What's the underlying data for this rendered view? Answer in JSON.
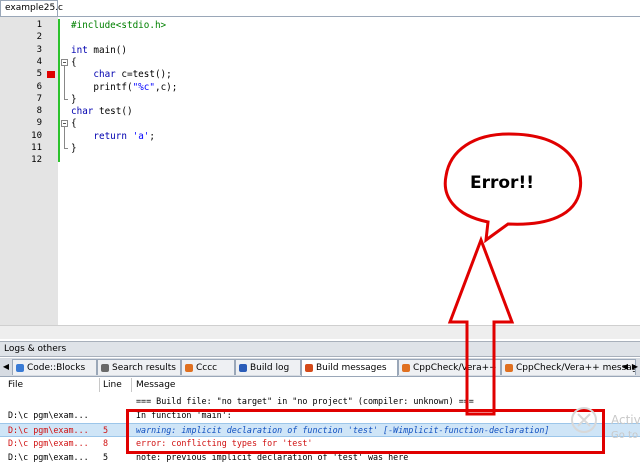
{
  "editor": {
    "tab_label": "example25.c",
    "line_numbers": [
      "1",
      "2",
      "3",
      "4",
      "5",
      "6",
      "7",
      "8",
      "9",
      "10",
      "11",
      "12"
    ],
    "code_lines": [
      [
        {
          "t": "#include<stdio.h>",
          "c": "pp"
        }
      ],
      [],
      [
        {
          "t": "int",
          "c": "kw"
        },
        {
          "t": " main()",
          "c": ""
        }
      ],
      [
        {
          "t": "{",
          "c": ""
        }
      ],
      [
        {
          "t": "    ",
          "c": ""
        },
        {
          "t": "char",
          "c": "kw"
        },
        {
          "t": " c=test();",
          "c": ""
        }
      ],
      [
        {
          "t": "    printf(",
          "c": ""
        },
        {
          "t": "\"%c\"",
          "c": "str"
        },
        {
          "t": ",c);",
          "c": ""
        }
      ],
      [
        {
          "t": "}",
          "c": ""
        }
      ],
      [
        {
          "t": "char",
          "c": "kw"
        },
        {
          "t": " test()",
          "c": ""
        }
      ],
      [
        {
          "t": "{",
          "c": ""
        }
      ],
      [
        {
          "t": "    ",
          "c": ""
        },
        {
          "t": "return",
          "c": "kw"
        },
        {
          "t": " ",
          "c": ""
        },
        {
          "t": "'a'",
          "c": "chr"
        },
        {
          "t": ";",
          "c": ""
        }
      ],
      [
        {
          "t": "}",
          "c": ""
        }
      ],
      []
    ],
    "error_marker_line": "5"
  },
  "logs": {
    "caption": "Logs & others",
    "tabs": [
      {
        "label": "Code::Blocks",
        "icon_color": "#3a7bd5"
      },
      {
        "label": "Search results",
        "icon_color": "#6a6a6a"
      },
      {
        "label": "Cccc",
        "icon_color": "#e07020"
      },
      {
        "label": "Build log",
        "icon_color": "#2a5cb8"
      },
      {
        "label": "Build messages",
        "icon_color": "#d44a1a"
      },
      {
        "label": "CppCheck/Vera++",
        "icon_color": "#e07020"
      },
      {
        "label": "CppCheck/Vera++ messages",
        "icon_color": "#e07020"
      }
    ],
    "active_tab": "Build messages",
    "columns": {
      "file": "File",
      "line": "Line",
      "message": "Message"
    },
    "rows": [
      {
        "file": "",
        "line": "",
        "message": "=== Build file: \"no target\" in \"no project\" (compiler: unknown) ===",
        "kind": "normal"
      },
      {
        "file": "D:\\c pgm\\exam...",
        "line": "",
        "message": "In function 'main':",
        "kind": "normal"
      },
      {
        "file": "D:\\c pgm\\exam...",
        "line": "5",
        "message": "warning: implicit declaration of function 'test' [-Wimplicit-function-declaration]",
        "kind": "warn"
      },
      {
        "file": "D:\\c pgm\\exam...",
        "line": "8",
        "message": "error: conflicting types for 'test'",
        "kind": "err"
      },
      {
        "file": "D:\\c pgm\\exam...",
        "line": "5",
        "message": "note: previous implicit declaration of 'test' was here",
        "kind": "normal"
      }
    ]
  },
  "annotation": {
    "bubble_text": "Error!!",
    "color": "#e00000"
  },
  "watermark": {
    "line1": "Activ",
    "line2": "Go to"
  }
}
